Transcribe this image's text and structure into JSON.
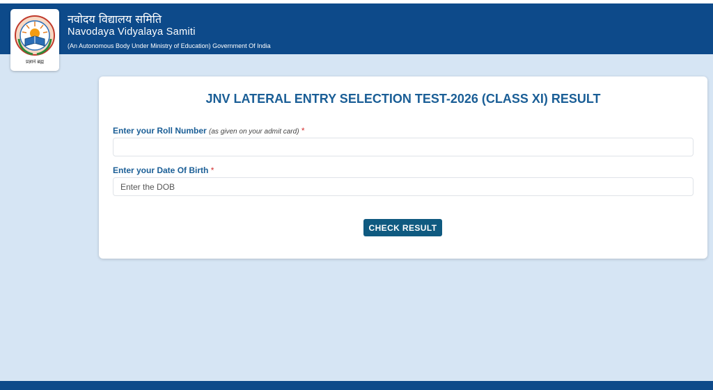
{
  "header": {
    "hindi_title": "नवोदय विद्यालय समिति",
    "english_title": "Navodaya Vidyalaya Samiti",
    "subtitle": "(An Autonomous Body Under Ministry of Education) Government Of India",
    "logo_text": "प्रज्ञानं ब्रह्म",
    "logo_icon": "nvs-emblem-icon"
  },
  "form": {
    "title": "JNV LATERAL ENTRY SELECTION TEST-2026 (CLASS XI) RESULT",
    "roll_label": "Enter your Roll Number",
    "roll_hint": "(as given on your admit card)",
    "roll_required": "*",
    "roll_value": "",
    "roll_placeholder": "",
    "dob_label": "Enter your Date Of Birth",
    "dob_required": "*",
    "dob_value": "",
    "dob_placeholder": "Enter the DOB",
    "submit_label": "CHECK RESULT"
  },
  "colors": {
    "header_bg": "#0d4a8a",
    "page_bg": "#d6e5f4",
    "title_color": "#1a5e96",
    "button_bg": "#0f5a80",
    "required_color": "#d32f2f"
  }
}
